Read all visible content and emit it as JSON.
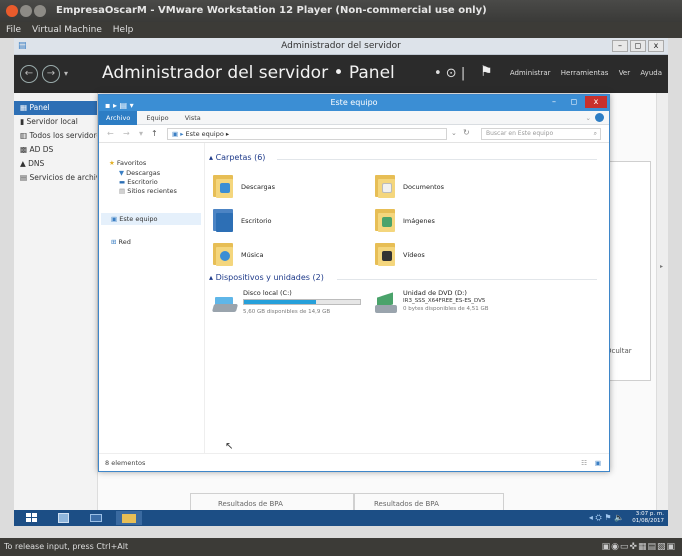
{
  "vmware": {
    "title": "EmpresaOscarM - VMware Workstation 12 Player (Non-commercial use only)",
    "menu": [
      "File",
      "Virtual Machine",
      "Help"
    ],
    "status_text": "To release input, press Ctrl+Alt",
    "status_icons": "▣◉▭✜▦▤▧▣"
  },
  "server_manager": {
    "window_title": "Administrador del servidor",
    "breadcrumb": "Administrador del servidor • Panel",
    "toolbar": [
      "Administrar",
      "Herramientas",
      "Ver",
      "Ayuda"
    ],
    "nav": [
      {
        "label": "Panel",
        "active": true
      },
      {
        "label": "Servidor local",
        "active": false
      },
      {
        "label": "Todos los servidores",
        "active": false
      },
      {
        "label": "AD DS",
        "active": false
      },
      {
        "label": "DNS",
        "active": false
      },
      {
        "label": "Servicios de archivos",
        "active": false
      }
    ],
    "hide_label": "Ocultar",
    "bpa_labels": [
      "Resultados de BPA",
      "Resultados de BPA"
    ]
  },
  "explorer": {
    "title": "Este equipo",
    "ribbon_tabs": [
      "Archivo",
      "Equipo",
      "Vista"
    ],
    "address": "Este equipo",
    "search_placeholder": "Buscar en Este equipo",
    "nav": {
      "favorites": "Favoritos",
      "favorites_items": [
        "Descargas",
        "Escritorio",
        "Sitios recientes"
      ],
      "this_pc": "Este equipo",
      "network": "Red"
    },
    "folders_header": "Carpetas (6)",
    "folders": [
      "Descargas",
      "Documentos",
      "Escritorio",
      "Imágenes",
      "Música",
      "Vídeos"
    ],
    "devices_header": "Dispositivos y unidades (2)",
    "drives": [
      {
        "name": "Disco local (C:)",
        "detail": "5,60 GB disponibles de 14,9 GB",
        "used_fraction": 0.62
      },
      {
        "name": "Unidad de DVD (D:)",
        "label2": "IR3_SSS_X64FREE_ES-ES_DV5",
        "detail": "0 bytes disponibles de 4,51 GB"
      }
    ],
    "status": "8 elementos"
  },
  "taskbar": {
    "time": "3:07 p. m.",
    "date": "01/08/2017",
    "tray": "◂ ⛭ ⚑ 🔈"
  }
}
